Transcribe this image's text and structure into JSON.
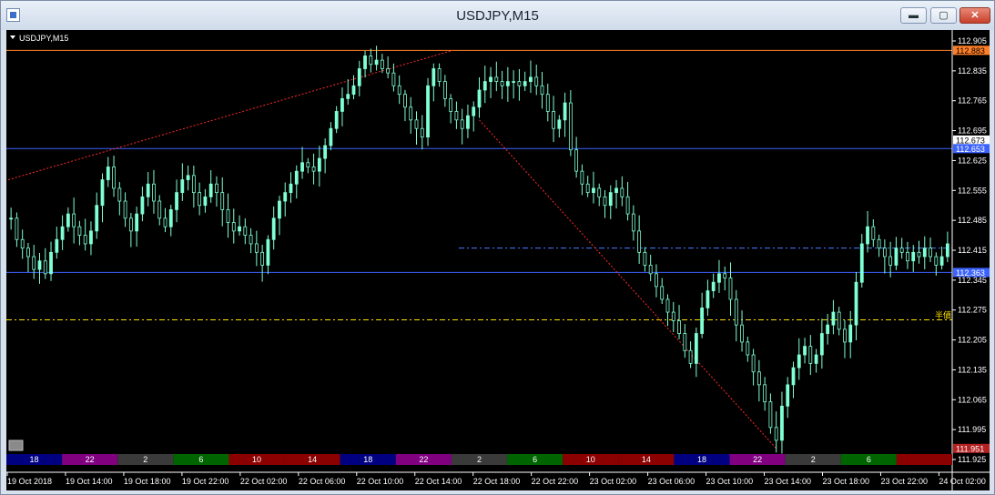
{
  "window": {
    "title": "USDJPY,M15",
    "buttons": {
      "minimize": "▬",
      "maximize": "▢",
      "close": "✕"
    }
  },
  "chart": {
    "symbol_label": "USDJPY,M15",
    "price_axis": [
      "112.905",
      "112.835",
      "112.765",
      "112.695",
      "112.625",
      "112.555",
      "112.485",
      "112.415",
      "112.345",
      "112.275",
      "112.205",
      "112.135",
      "112.065",
      "111.995",
      "111.925"
    ],
    "hlines": [
      {
        "price": 112.883,
        "color": "#ff7f27",
        "label": "112.883"
      },
      {
        "price": 112.653,
        "color": "#3d63ff",
        "label": "112.653"
      },
      {
        "price": 112.363,
        "color": "#3d63ff",
        "label": "112.363"
      }
    ],
    "current_price": {
      "price": 112.673,
      "label": "112.673"
    },
    "bottom_price": {
      "price": 111.951,
      "label": "111.951"
    },
    "yellow_line": {
      "price": 112.252,
      "label": "半値",
      "color": "#ffe200"
    },
    "blue_dash_line": {
      "price": 112.42,
      "color": "#4b7bff"
    },
    "session_bar": [
      {
        "label": "18",
        "color": "#000080"
      },
      {
        "label": "22",
        "color": "#800080"
      },
      {
        "label": "2",
        "color": "#3a3a3a"
      },
      {
        "label": "6",
        "color": "#006400"
      },
      {
        "label": "10",
        "color": "#8b0000"
      },
      {
        "label": "14",
        "color": "#8b0000"
      },
      {
        "label": "18",
        "color": "#000080"
      },
      {
        "label": "22",
        "color": "#800080"
      },
      {
        "label": "2",
        "color": "#3a3a3a"
      },
      {
        "label": "6",
        "color": "#006400"
      },
      {
        "label": "10",
        "color": "#8b0000"
      },
      {
        "label": "14",
        "color": "#8b0000"
      },
      {
        "label": "18",
        "color": "#000080"
      },
      {
        "label": "22",
        "color": "#800080"
      },
      {
        "label": "2",
        "color": "#3a3a3a"
      },
      {
        "label": "6",
        "color": "#006400"
      },
      {
        "label": "",
        "color": "#8b0000"
      }
    ],
    "time_axis": [
      "19 Oct 2018",
      "19 Oct 14:00",
      "19 Oct 18:00",
      "19 Oct 22:00",
      "22 Oct 02:00",
      "22 Oct 06:00",
      "22 Oct 10:00",
      "22 Oct 14:00",
      "22 Oct 18:00",
      "22 Oct 22:00",
      "23 Oct 02:00",
      "23 Oct 06:00",
      "23 Oct 10:00",
      "23 Oct 14:00",
      "23 Oct 18:00",
      "23 Oct 22:00",
      "24 Oct 02:00"
    ],
    "candle_color": "#7fffd4",
    "trend_color": "#ff2a2a",
    "price_series": [
      112.49,
      112.44,
      112.42,
      112.4,
      112.37,
      112.39,
      112.36,
      112.41,
      112.44,
      112.47,
      112.5,
      112.47,
      112.45,
      112.43,
      112.46,
      112.52,
      112.58,
      112.61,
      112.56,
      112.53,
      112.49,
      112.46,
      112.5,
      112.54,
      112.57,
      112.53,
      112.49,
      112.47,
      112.51,
      112.55,
      112.58,
      112.59,
      112.55,
      112.52,
      112.54,
      112.57,
      112.55,
      112.51,
      112.48,
      112.46,
      112.47,
      112.45,
      112.43,
      112.41,
      112.38,
      112.44,
      112.49,
      112.53,
      112.55,
      112.57,
      112.6,
      112.62,
      112.61,
      112.6,
      112.63,
      112.66,
      112.7,
      112.74,
      112.77,
      112.78,
      112.8,
      112.84,
      112.87,
      112.85,
      112.86,
      112.84,
      112.83,
      112.8,
      112.78,
      112.75,
      112.72,
      112.7,
      112.68,
      112.8,
      112.84,
      112.81,
      112.77,
      112.74,
      112.72,
      112.7,
      112.73,
      112.75,
      112.79,
      112.81,
      112.82,
      112.81,
      112.8,
      112.81,
      112.81,
      112.8,
      112.81,
      112.82,
      112.8,
      112.78,
      112.74,
      112.7,
      112.72,
      112.76,
      112.65,
      112.6,
      112.57,
      112.55,
      112.56,
      112.54,
      112.52,
      112.55,
      112.56,
      112.54,
      112.5,
      112.46,
      112.41,
      112.38,
      112.36,
      112.33,
      112.3,
      112.27,
      112.25,
      112.22,
      112.18,
      112.15,
      112.22,
      112.28,
      112.32,
      112.34,
      112.36,
      112.35,
      112.3,
      112.24,
      112.2,
      112.17,
      112.13,
      112.1,
      112.06,
      112.0,
      111.97,
      112.05,
      112.1,
      112.14,
      112.17,
      112.19,
      112.15,
      112.17,
      112.22,
      112.24,
      112.27,
      112.23,
      112.2,
      112.24,
      112.34,
      112.43,
      112.47,
      112.44,
      112.42,
      112.4,
      112.38,
      112.42,
      112.41,
      112.39,
      112.41,
      112.4,
      112.42,
      112.4,
      112.38,
      112.4,
      112.43
    ]
  }
}
